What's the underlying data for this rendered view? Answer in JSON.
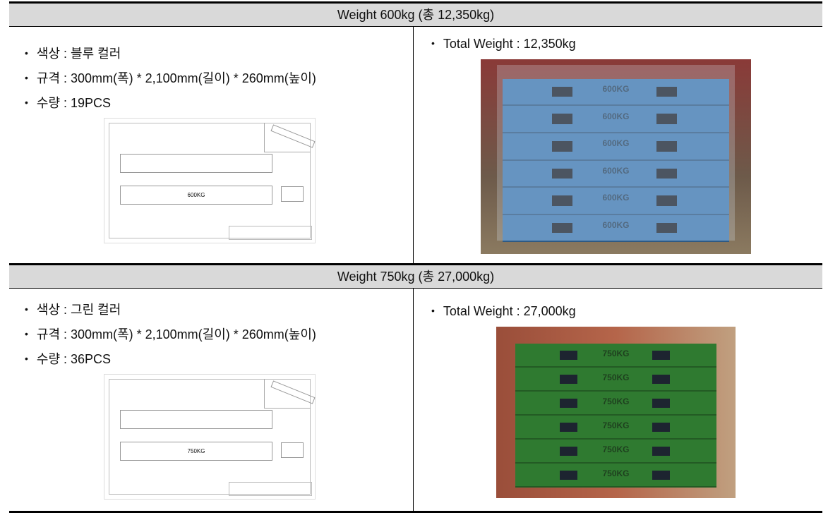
{
  "sections": [
    {
      "header": "Weight 600kg (총 12,350kg)",
      "specs": [
        "색상 : 블루 컬러",
        "규격 : 300mm(폭) * 2,100mm(길이) * 260mm(높이)",
        "수량 : 19PCS"
      ],
      "drawing_label": "600KG",
      "total_weight": "Total Weight : 12,350kg",
      "photo_label": "600KG",
      "color": "#3f78b0"
    },
    {
      "header": "Weight 750kg (총 27,000kg)",
      "specs": [
        "색상 : 그린 컬러",
        "규격 : 300mm(폭) * 2,100mm(길이) * 260mm(높이)",
        "수량 : 36PCS"
      ],
      "drawing_label": "750KG",
      "total_weight": "Total Weight : 27,000kg",
      "photo_label": "750KG",
      "color": "#2f7a30"
    }
  ]
}
